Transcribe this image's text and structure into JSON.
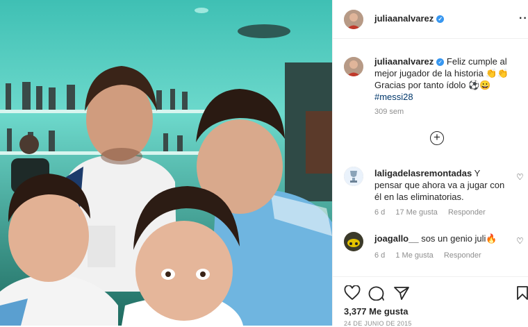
{
  "post": {
    "username": "juliaanalvarez",
    "caption_text": "Feliz cumple al mejor jugador de la historia 👏👏 Gracias por tanto ídolo ⚽😀",
    "hashtag": "#messi28",
    "time_ago": "309 sem",
    "likes": "3,377 Me gusta",
    "date": "24 DE JUNIO DE 2015"
  },
  "comments": [
    {
      "username": "laligadelasremontadas",
      "text": "Y pensar que ahora va a jugar con él en las eliminatorias.",
      "age": "6 d",
      "likes": "17 Me gusta",
      "reply": "Responder"
    },
    {
      "username": "joagallo__",
      "text": "sos un genio juli🔥",
      "age": "6 d",
      "likes": "1 Me gusta",
      "reply": "Responder"
    }
  ],
  "icons": {
    "like": "heart-icon",
    "comment": "comment-icon",
    "share": "share-icon",
    "save": "bookmark-icon",
    "verified": "verified-badge-icon",
    "more": "more-options-icon",
    "load_more": "plus-circle-icon"
  },
  "colors": {
    "verified": "#3897f0",
    "hashtag": "#00376b",
    "secondary_text": "#8e8e8e"
  }
}
